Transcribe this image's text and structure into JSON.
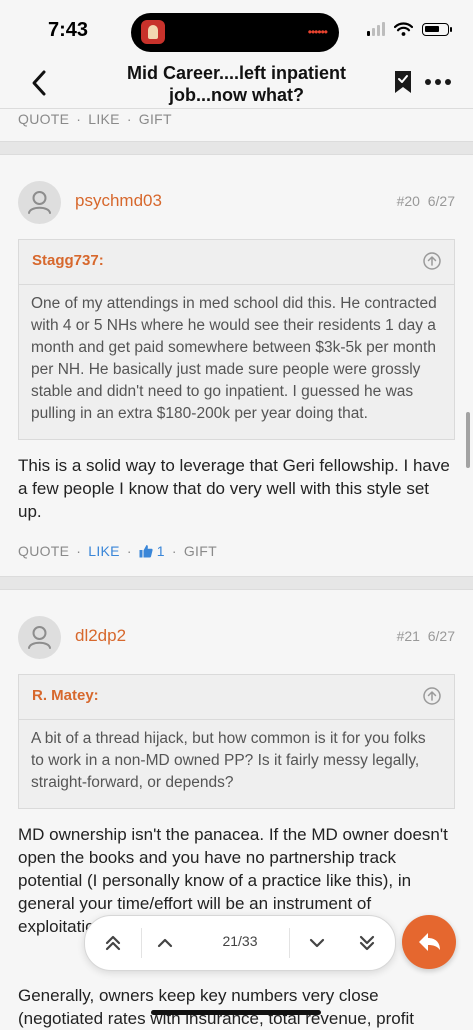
{
  "status_bar": {
    "time": "7:43",
    "island_dots": "••••••"
  },
  "nav": {
    "title": "Mid Career....left inpatient job...now what?"
  },
  "top_actions": {
    "quote": "QUOTE",
    "like": "LIKE",
    "gift": "GIFT",
    "separator": "·"
  },
  "posts": [
    {
      "username": "psychmd03",
      "number": "#20",
      "date": "6/27",
      "quote": {
        "author": "Stagg737:",
        "text": "One of my attendings in med school did this. He contracted with 4 or 5 NHs where he would see their residents 1 day a month and get paid somewhere between $3k-5k per month per NH. He basically just made sure people were grossly stable and didn't need to go inpatient. I guessed he was pulling in an extra $180-200k per year doing that."
      },
      "body": "This is a solid way to leverage that Geri fellowship. I have a few people I know that do very well with this style set up.",
      "actions": {
        "quote": "QUOTE",
        "like": "LIKE",
        "like_count": "1",
        "gift": "GIFT"
      }
    },
    {
      "username": "dl2dp2",
      "number": "#21",
      "date": "6/27",
      "quote": {
        "author": "R. Matey:",
        "text": "A bit of a thread hijack, but how common is it for you folks to work in a non-MD owned PP? Is it fairly messy legally, straight-forward, or depends?"
      },
      "body": "MD ownership isn't the panacea. If the MD owner doesn't open the books and you have no partnership track potential (I personally know of a practice like this), in general your time/effort will be an instrument of exploitation.",
      "body2": "Generally, owners keep key numbers very close (negotiated rates with insurance, total revenue, profit"
    }
  ],
  "pager": {
    "label": "21/33"
  },
  "colors": {
    "accent": "#d7682d",
    "like_blue": "#3a86d8",
    "reply_button": "#e5672f"
  },
  "icons": [
    "back-chevron-icon",
    "bookmark-check-icon",
    "more-dots-icon",
    "user-avatar-icon",
    "arrow-up-circle-icon",
    "thumbs-up-icon",
    "double-chevron-up-icon",
    "chevron-up-icon",
    "chevron-down-icon",
    "double-chevron-down-icon",
    "reply-arrow-icon"
  ]
}
